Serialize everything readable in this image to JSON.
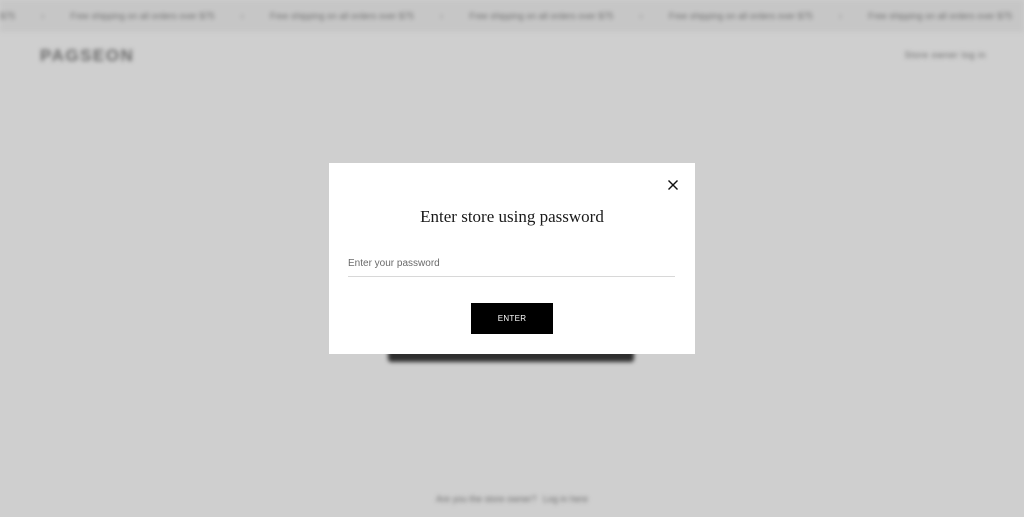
{
  "announcement": {
    "items": [
      "Free shipping on all orders over $75",
      "Free shipping on all orders over $75",
      "Free shipping on all orders over $75",
      "Free shipping on all orders over $75",
      "Free shipping on all orders over $75"
    ],
    "separator": "›",
    "leading_fragment": "$75"
  },
  "header": {
    "logo": "PAGSEON",
    "owner_login": "Store owner log in"
  },
  "footer": {
    "question": "Are you the store owner?",
    "link": "Log in here"
  },
  "modal": {
    "title": "Enter store using password",
    "password_placeholder": "Enter your password",
    "password_value": "",
    "enter_label": "ENTER",
    "close_icon": "close-icon"
  },
  "colors": {
    "overlay_bg": "#cfcfcf",
    "modal_bg": "#ffffff",
    "button_bg": "#000000",
    "button_text": "#ffffff"
  }
}
